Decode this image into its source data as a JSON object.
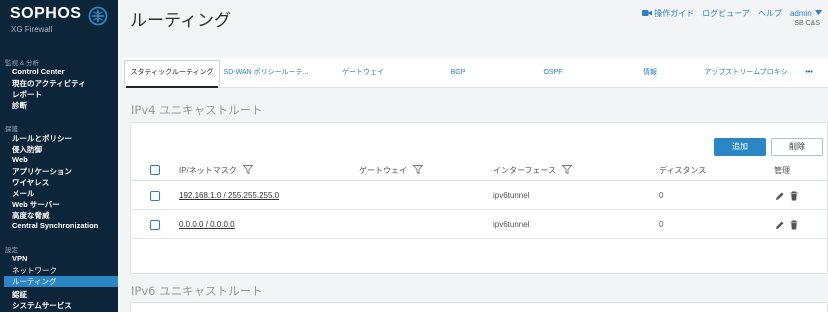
{
  "brand": {
    "name": "SOPHOS",
    "product": "XG Firewall"
  },
  "sidebar": {
    "groups": [
      {
        "label": "監視 & 分析",
        "items": [
          "Control Center",
          "現在のアクティビティ",
          "レポート",
          "診断"
        ]
      },
      {
        "label": "保護",
        "items": [
          "ルールとポリシー",
          "侵入防御",
          "Web",
          "アプリケーション",
          "ワイヤレス",
          "メール",
          "Web サーバー",
          "高度な脅威",
          "Central Synchronization"
        ]
      },
      {
        "label": "設定",
        "items": [
          "VPN",
          "ネットワーク",
          "ルーティング",
          "認証",
          "システムサービス"
        ]
      }
    ]
  },
  "header": {
    "title": "ルーティング",
    "links": {
      "guide": "操作ガイド",
      "log_viewer": "ログビューア",
      "help": "ヘルプ",
      "user": "admin"
    },
    "company": "SB C&S"
  },
  "tabs": [
    "スタティックルーティング",
    "SD-WAN ポリシールーテ...",
    "ゲートウェイ",
    "BGP",
    "OSPF",
    "情報",
    "アップストリームプロキシ",
    "•••"
  ],
  "ipv4": {
    "title": "IPv4 ユニキャストルート",
    "add_label": "追加",
    "delete_label": "削除",
    "columns": [
      "IP/ネットマスク",
      "ゲートウェイ",
      "インターフェース",
      "ディスタンス",
      "管理"
    ],
    "rows": [
      {
        "ip": "192.168.1.0 / 255.255.255.0",
        "gateway": "",
        "interface": "ipv6tunnel",
        "distance": "0"
      },
      {
        "ip": "0.0.0.0 / 0.0.0.0",
        "gateway": "",
        "interface": "ipv6tunnel",
        "distance": "0"
      }
    ]
  },
  "ipv6": {
    "title": "IPv6 ユニキャストルート"
  },
  "colors": {
    "sidebar_bg": "#0d2538",
    "accent": "#2b86c5",
    "link": "#2b7fc1"
  }
}
